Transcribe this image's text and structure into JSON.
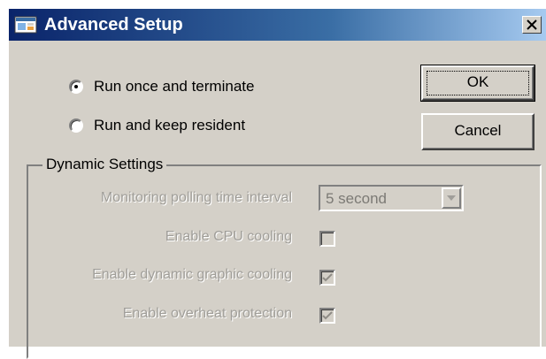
{
  "window": {
    "title": "Advanced Setup",
    "icon": "app-window-icon",
    "close_label": "×"
  },
  "run_mode": {
    "options": [
      {
        "label": "Run once and terminate",
        "selected": true
      },
      {
        "label": "Run and keep resident",
        "selected": false
      }
    ]
  },
  "buttons": {
    "ok": "OK",
    "cancel": "Cancel"
  },
  "dynamic_settings": {
    "group_title": "Dynamic Settings",
    "polling_label": "Monitoring polling time interval",
    "polling_value": "5 second",
    "cpu_label": "Enable CPU cooling",
    "cpu_checked": false,
    "graphic_label": "Enable dynamic graphic cooling",
    "graphic_checked": true,
    "overheat_label": "Enable overheat protection",
    "overheat_checked": true
  },
  "colors": {
    "titlebar_start": "#0a246a",
    "titlebar_end": "#a6caf0",
    "face": "#d4d0c8",
    "disabled_text": "#a09e99"
  }
}
